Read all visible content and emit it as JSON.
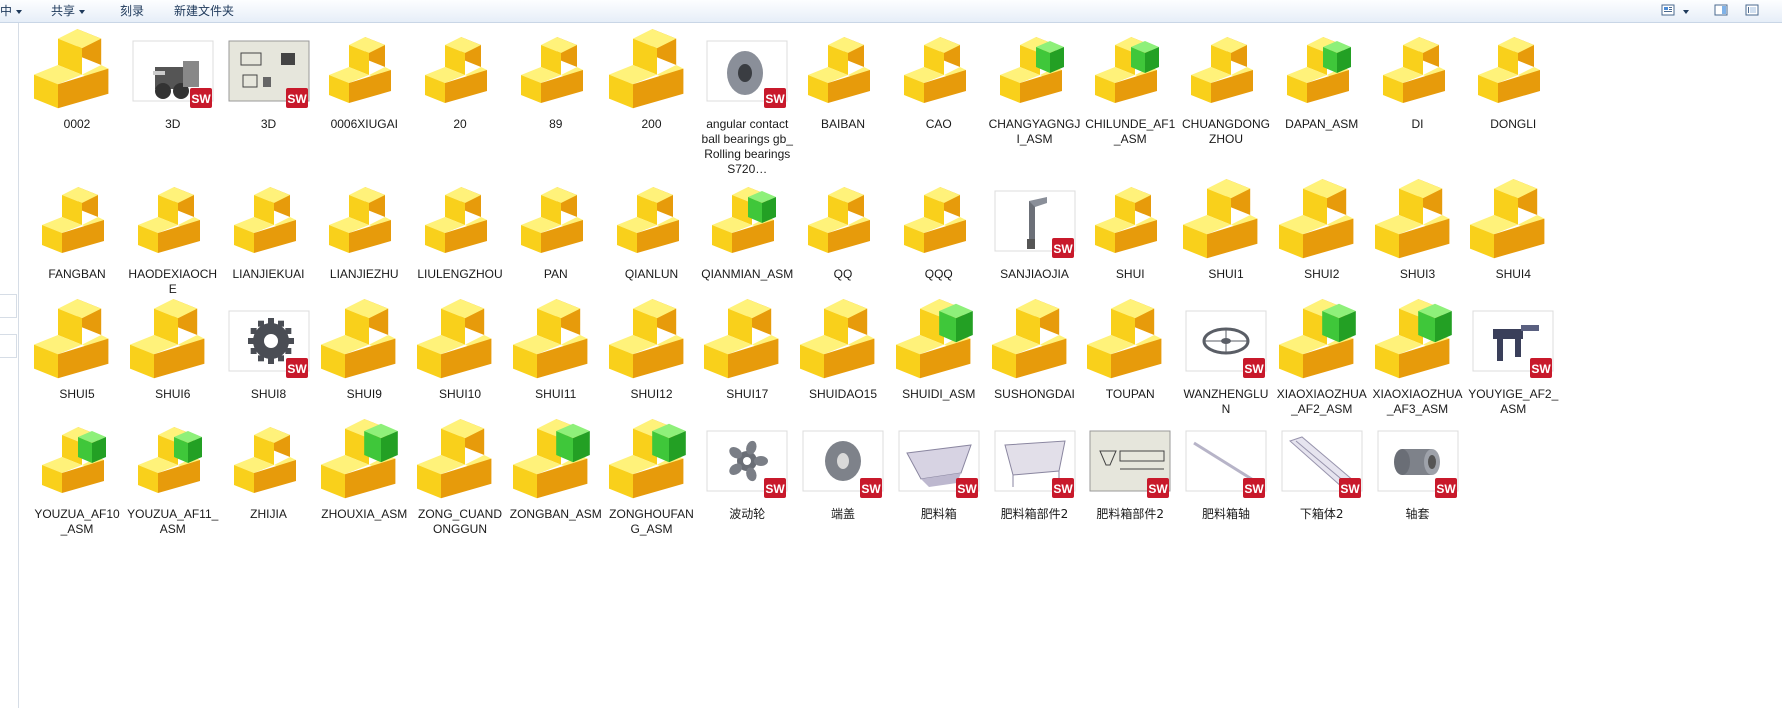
{
  "toolbar": {
    "left_partial": "中",
    "share": "共享",
    "burn": "刻录",
    "new_folder": "新建文件夹"
  },
  "colors": {
    "folder_yellow": "#f9d01b",
    "folder_orange": "#e79b0b",
    "assembly_green": "#3fc73a",
    "sw_badge_red": "#c8192b"
  },
  "files": [
    {
      "name": "0002",
      "icon": "part-icon-large"
    },
    {
      "name": "3D",
      "icon": "sw-thumbnail-machine"
    },
    {
      "name": "3D",
      "icon": "sw-thumbnail-drawing"
    },
    {
      "name": "0006XIUGAI",
      "icon": "part-icon"
    },
    {
      "name": "20",
      "icon": "part-icon"
    },
    {
      "name": "89",
      "icon": "part-icon"
    },
    {
      "name": "200",
      "icon": "part-icon-large"
    },
    {
      "name": "angular contact ball bearings gb_Rolling bearings S720…",
      "icon": "sw-thumbnail-bearing"
    },
    {
      "name": "BAIBAN",
      "icon": "part-icon"
    },
    {
      "name": "CAO",
      "icon": "part-icon"
    },
    {
      "name": "CHANGYAGNGJI_ASM",
      "icon": "assembly-icon"
    },
    {
      "name": "CHILUNDE_AF1_ASM",
      "icon": "assembly-icon"
    },
    {
      "name": "CHUANGDONGZHOU",
      "icon": "part-icon"
    },
    {
      "name": "DAPAN_ASM",
      "icon": "assembly-icon"
    },
    {
      "name": "DI",
      "icon": "part-icon"
    },
    {
      "name": "DONGLI",
      "icon": "part-icon"
    },
    {
      "name": "FANGBAN",
      "icon": "part-icon"
    },
    {
      "name": "HAODEXIAOCHE",
      "icon": "part-icon"
    },
    {
      "name": "LIANJIEKUAI",
      "icon": "part-icon"
    },
    {
      "name": "LIANJIEZHU",
      "icon": "part-icon"
    },
    {
      "name": "LIULENGZHOU",
      "icon": "part-icon"
    },
    {
      "name": "PAN",
      "icon": "part-icon"
    },
    {
      "name": "QIANLUN",
      "icon": "part-icon"
    },
    {
      "name": "QIANMIAN_ASM",
      "icon": "assembly-icon"
    },
    {
      "name": "QQ",
      "icon": "part-icon"
    },
    {
      "name": "QQQ",
      "icon": "part-icon"
    },
    {
      "name": "SANJIAOJIA",
      "icon": "sw-thumbnail-bracket"
    },
    {
      "name": "SHUI",
      "icon": "part-icon"
    },
    {
      "name": "SHUI1",
      "icon": "part-icon-large"
    },
    {
      "name": "SHUI2",
      "icon": "part-icon-large"
    },
    {
      "name": "SHUI3",
      "icon": "part-icon-large"
    },
    {
      "name": "SHUI4",
      "icon": "part-icon-large"
    },
    {
      "name": "SHUI5",
      "icon": "part-icon-large"
    },
    {
      "name": "SHUI6",
      "icon": "part-icon-large"
    },
    {
      "name": "SHUI8",
      "icon": "sw-thumbnail-gear"
    },
    {
      "name": "SHUI9",
      "icon": "part-icon-large"
    },
    {
      "name": "SHUI10",
      "icon": "part-icon-large"
    },
    {
      "name": "SHUI11",
      "icon": "part-icon-large"
    },
    {
      "name": "SHUI12",
      "icon": "part-icon-large"
    },
    {
      "name": "SHUI17",
      "icon": "part-icon-large"
    },
    {
      "name": "SHUIDAO15",
      "icon": "part-icon-large"
    },
    {
      "name": "SHUIDI_ASM",
      "icon": "assembly-icon-large"
    },
    {
      "name": "SUSHONGDAI",
      "icon": "part-icon-large"
    },
    {
      "name": "TOUPAN",
      "icon": "part-icon-large"
    },
    {
      "name": "WANZHENGLUN",
      "icon": "sw-thumbnail-wheel"
    },
    {
      "name": "XIAOXIAOZHUA_AF2_ASM",
      "icon": "assembly-icon-large"
    },
    {
      "name": "XIAOXIAOZHUA_AF3_ASM",
      "icon": "assembly-icon-large"
    },
    {
      "name": "YOUYIGE_AF2_ASM",
      "icon": "sw-thumbnail-robot"
    },
    {
      "name": "YOUZUA_AF10_ASM",
      "icon": "assembly-icon"
    },
    {
      "name": "YOUZUA_AF11_ASM",
      "icon": "assembly-icon"
    },
    {
      "name": "ZHIJIA",
      "icon": "part-icon"
    },
    {
      "name": "ZHOUXIA_ASM",
      "icon": "assembly-icon-large"
    },
    {
      "name": "ZONG_CUANDONGGUN",
      "icon": "part-icon-large"
    },
    {
      "name": "ZONGBAN_ASM",
      "icon": "assembly-icon-large"
    },
    {
      "name": "ZONGHOUFANG_ASM",
      "icon": "assembly-icon-large"
    },
    {
      "name": "波动轮",
      "icon": "sw-thumbnail-star-wheel"
    },
    {
      "name": "端盖",
      "icon": "sw-thumbnail-cap"
    },
    {
      "name": "肥料箱",
      "icon": "sw-thumbnail-hopper"
    },
    {
      "name": "肥料箱部件2",
      "icon": "sw-thumbnail-hopper2"
    },
    {
      "name": "肥料箱部件2",
      "icon": "sw-thumbnail-hopper-drawing"
    },
    {
      "name": "肥料箱轴",
      "icon": "sw-thumbnail-shaft"
    },
    {
      "name": "下箱体2",
      "icon": "sw-thumbnail-tray"
    },
    {
      "name": "轴套",
      "icon": "sw-thumbnail-sleeve"
    }
  ]
}
